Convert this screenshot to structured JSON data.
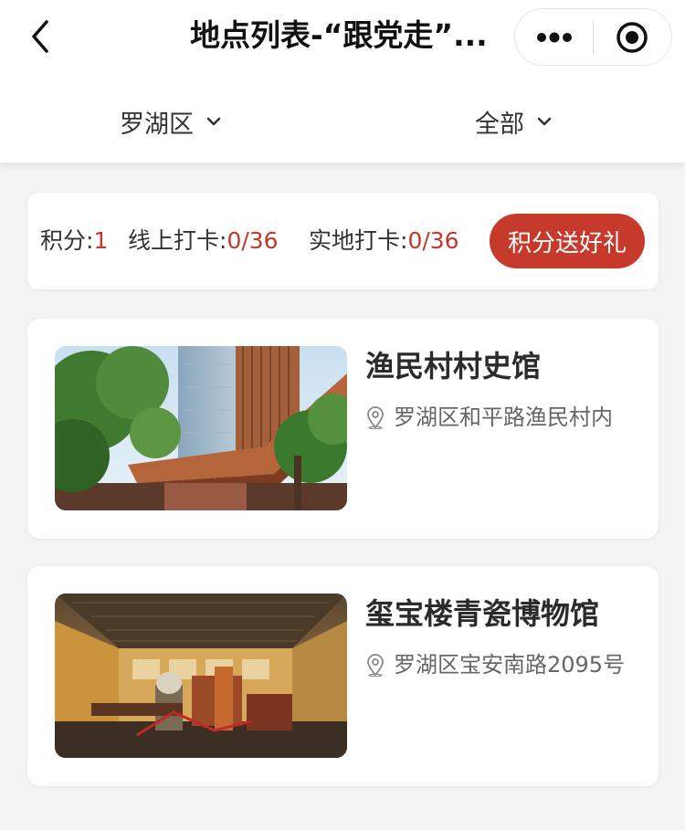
{
  "header": {
    "title": "地点列表-“跟党走”...",
    "back_icon": "chevron-left-icon",
    "more_icon": "more-dots-icon",
    "close_icon": "target-close-icon"
  },
  "filters": {
    "district": "罗湖区",
    "category": "全部"
  },
  "stats": {
    "points_label": "积分:",
    "points_value": "1",
    "online_label": "线上打卡:",
    "online_value": "0/36",
    "onsite_label": "实地打卡:",
    "onsite_value": "0/36",
    "gift_button": "积分送好礼"
  },
  "colors": {
    "accent": "#c53a2a",
    "value_red": "#c0392b",
    "background": "#f3f3f3"
  },
  "places": [
    {
      "name": "渔民村村史馆",
      "address": "罗湖区和平路渔民村内",
      "image": "fishing-village-museum-photo"
    },
    {
      "name": "玺宝楼青瓷博物馆",
      "address": "罗湖区宝安南路2095号",
      "image": "celadon-museum-interior-photo"
    }
  ]
}
